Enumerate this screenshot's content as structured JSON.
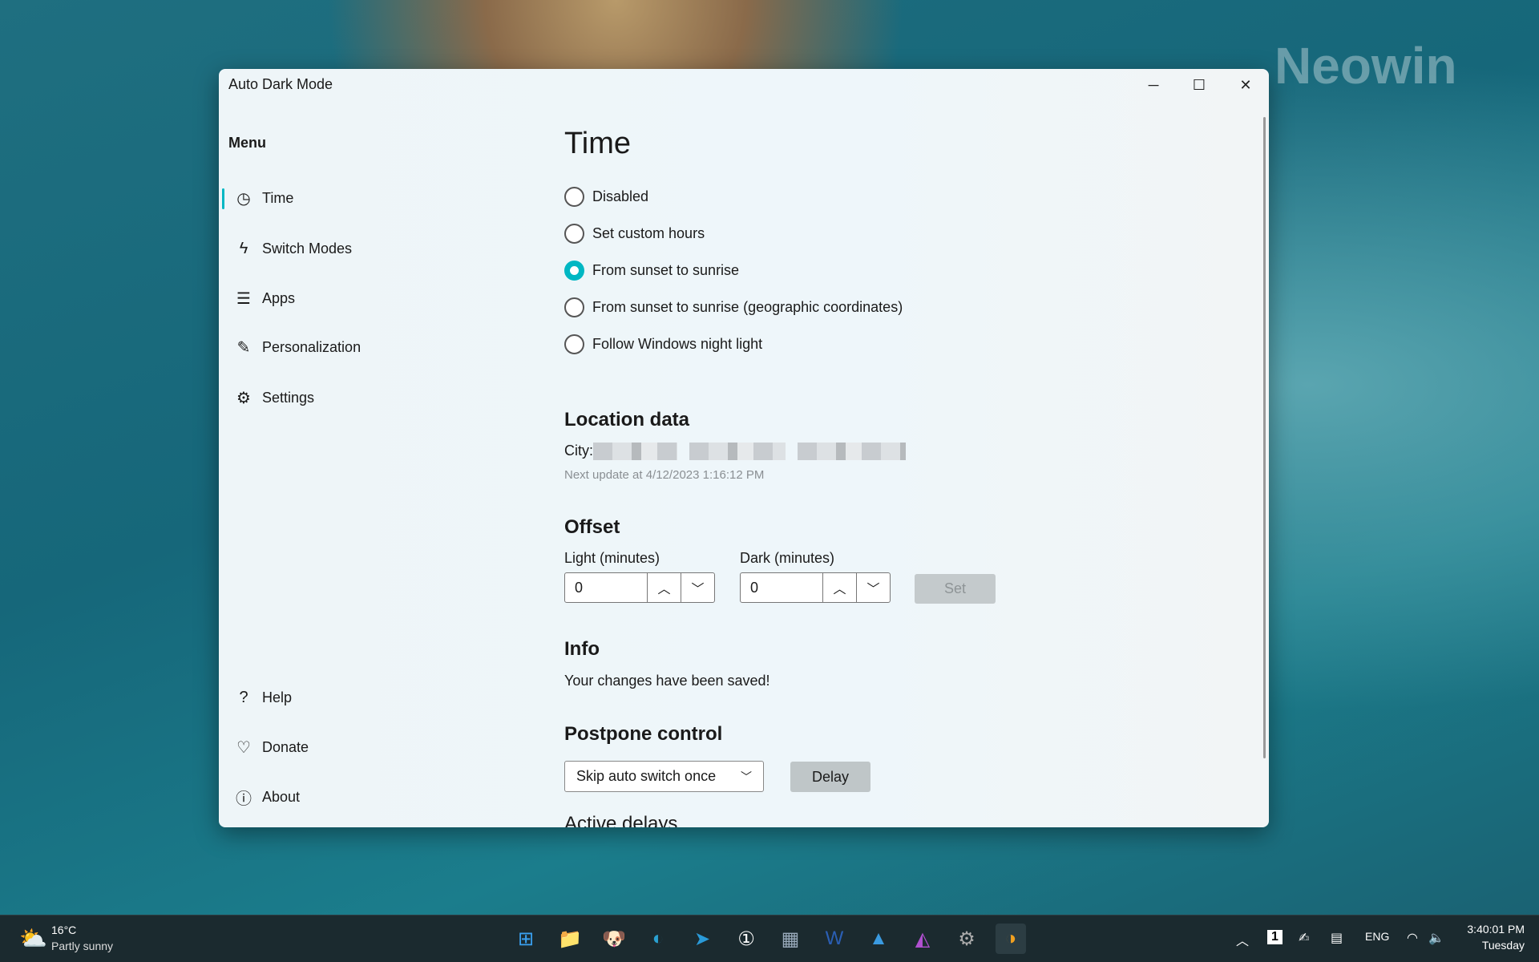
{
  "wallpaper": {
    "watermark": "Neowin"
  },
  "window": {
    "title": "Auto Dark Mode",
    "controls": {
      "minimize": "─",
      "maximize": "☐",
      "close": "✕"
    }
  },
  "sidebar": {
    "menu_label": "Menu",
    "items": [
      {
        "label": "Time",
        "icon": "clock-icon",
        "glyph": "◷",
        "active": true
      },
      {
        "label": "Switch Modes",
        "icon": "lightning-icon",
        "glyph": "ϟ"
      },
      {
        "label": "Apps",
        "icon": "list-icon",
        "glyph": "☰"
      },
      {
        "label": "Personalization",
        "icon": "personalization-icon",
        "glyph": "✎"
      },
      {
        "label": "Settings",
        "icon": "gear-icon",
        "glyph": "⚙"
      }
    ],
    "footer": [
      {
        "label": "Help",
        "icon": "help-icon",
        "glyph": "?"
      },
      {
        "label": "Donate",
        "icon": "heart-icon",
        "glyph": "♡"
      },
      {
        "label": "About",
        "icon": "info-icon",
        "glyph": "ⓘ"
      }
    ]
  },
  "main": {
    "title": "Time",
    "options": [
      {
        "label": "Disabled",
        "checked": false
      },
      {
        "label": "Set custom hours",
        "checked": false
      },
      {
        "label": "From sunset to sunrise",
        "checked": true
      },
      {
        "label": "From sunset to sunrise (geographic coordinates)",
        "checked": false
      },
      {
        "label": "Follow Windows night light",
        "checked": false
      }
    ],
    "location": {
      "heading": "Location data",
      "city_label": "City:",
      "next_update": "Next update at  4/12/2023 1:16:12 PM"
    },
    "offset": {
      "heading": "Offset",
      "light_label": "Light (minutes)",
      "light_value": "0",
      "dark_label": "Dark (minutes)",
      "dark_value": "0",
      "set_label": "Set"
    },
    "info": {
      "heading": "Info",
      "message": "Your changes have been saved!"
    },
    "postpone": {
      "heading": "Postpone control",
      "selected": "Skip auto switch once",
      "delay_label": "Delay",
      "active_delays": "Active delays"
    }
  },
  "accent": "#00b7c3",
  "taskbar": {
    "weather_temp": "16°C",
    "weather_desc": "Partly sunny",
    "apps": [
      "start",
      "file-explorer",
      "app",
      "edge",
      "telegram",
      "1password",
      "calculator",
      "word",
      "affinity-designer",
      "affinity-photo",
      "settings",
      "auto-dark-mode"
    ],
    "tray": {
      "badge": "1",
      "language": "ENG",
      "time": "3:40:01 PM",
      "day": "Tuesday"
    }
  }
}
